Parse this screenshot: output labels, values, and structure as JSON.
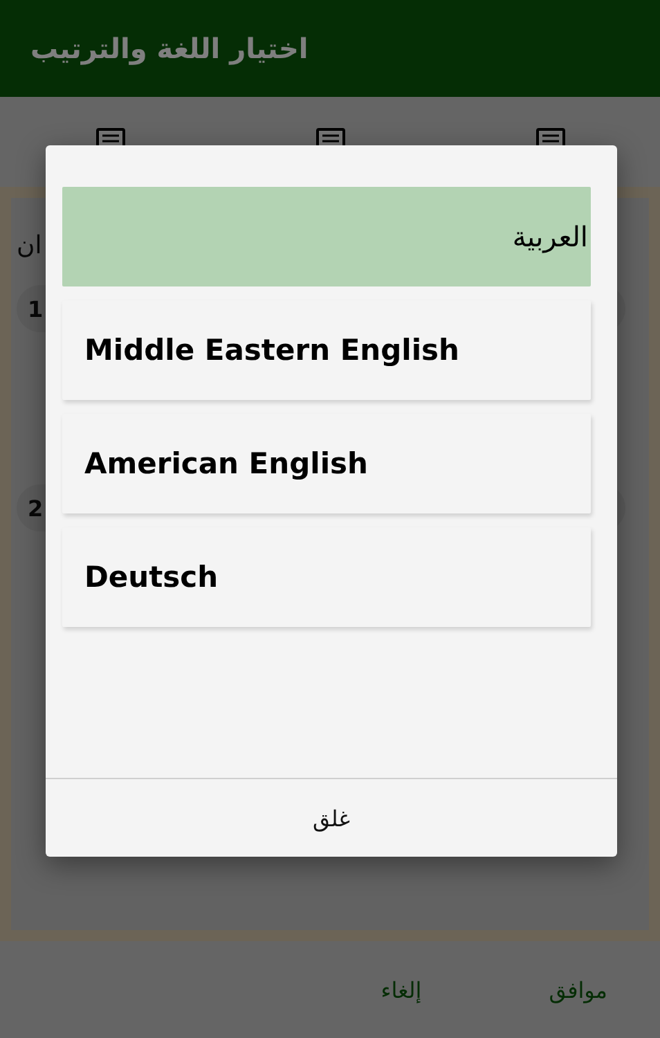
{
  "app_bar": {
    "title": "اختيار اللغة والترتيب"
  },
  "tabs": [
    {
      "selected": false
    },
    {
      "selected": false
    },
    {
      "selected": false
    }
  ],
  "content": {
    "label_fragment": "ان",
    "rows": [
      {
        "number": "1"
      },
      {
        "number": "2"
      }
    ]
  },
  "bottom_bar": {
    "buttons": [
      "موافق",
      "إلغاء"
    ]
  },
  "dialog": {
    "options": [
      {
        "label": "العربية",
        "kind": "rtl",
        "selected": true
      },
      {
        "label": "Middle Eastern English",
        "kind": "ltr",
        "selected": false
      },
      {
        "label": "American English",
        "kind": "ltr",
        "selected": false
      },
      {
        "label": "Deutsch",
        "kind": "ltr",
        "selected": false
      }
    ],
    "close_label": "غلق"
  }
}
